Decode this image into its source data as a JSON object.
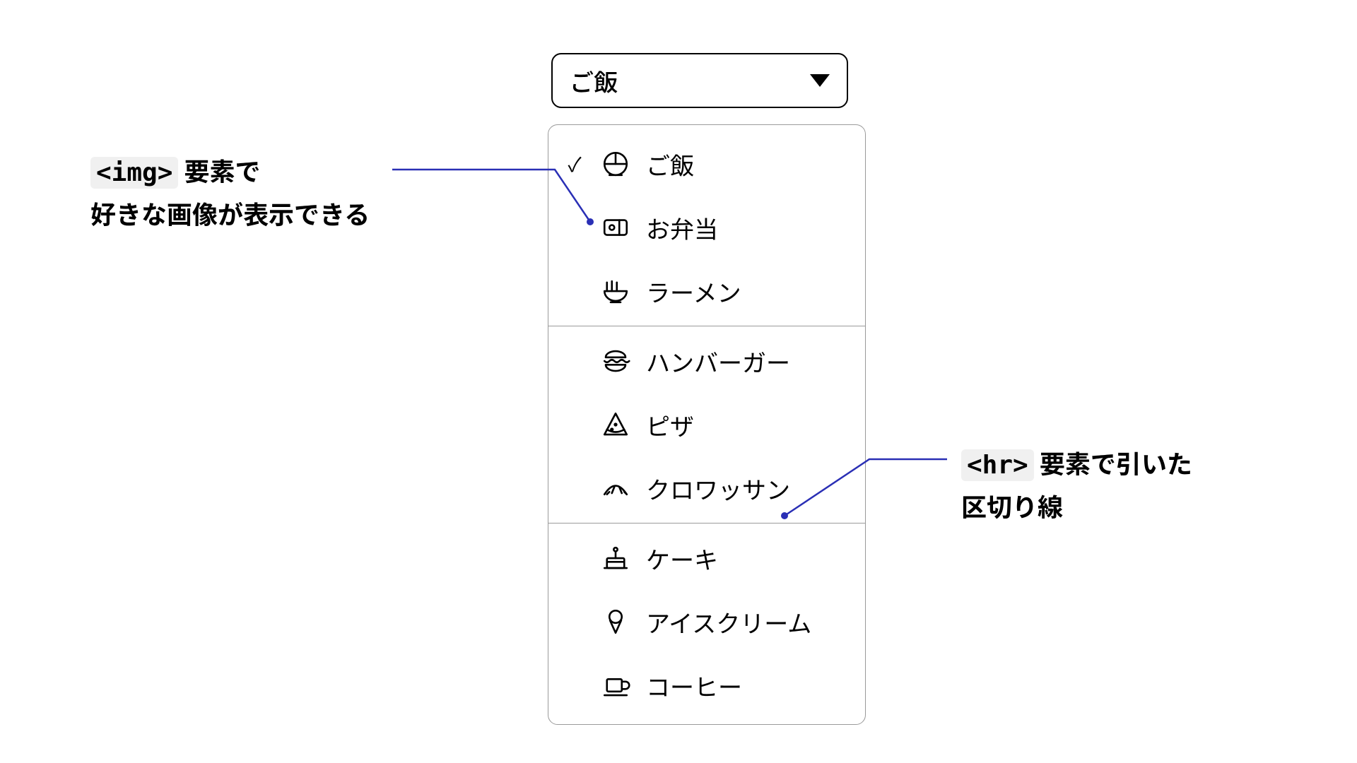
{
  "select": {
    "value": "ご飯"
  },
  "groups": [
    {
      "items": [
        {
          "label": "ご飯",
          "icon": "rice-bowl-icon",
          "selected": true
        },
        {
          "label": "お弁当",
          "icon": "bento-icon",
          "selected": false
        },
        {
          "label": "ラーメン",
          "icon": "ramen-icon",
          "selected": false
        }
      ]
    },
    {
      "items": [
        {
          "label": "ハンバーガー",
          "icon": "hamburger-icon",
          "selected": false
        },
        {
          "label": "ピザ",
          "icon": "pizza-icon",
          "selected": false
        },
        {
          "label": "クロワッサン",
          "icon": "croissant-icon",
          "selected": false
        }
      ]
    },
    {
      "items": [
        {
          "label": "ケーキ",
          "icon": "cake-icon",
          "selected": false
        },
        {
          "label": "アイスクリーム",
          "icon": "icecream-icon",
          "selected": false
        },
        {
          "label": "コーヒー",
          "icon": "coffee-icon",
          "selected": false
        }
      ]
    }
  ],
  "annotations": {
    "left": {
      "code": "<img>",
      "text1": " 要素で",
      "text2": "好きな画像が表示できる"
    },
    "right": {
      "code": "<hr>",
      "text1": " 要素で引いた",
      "text2": "区切り線"
    }
  }
}
